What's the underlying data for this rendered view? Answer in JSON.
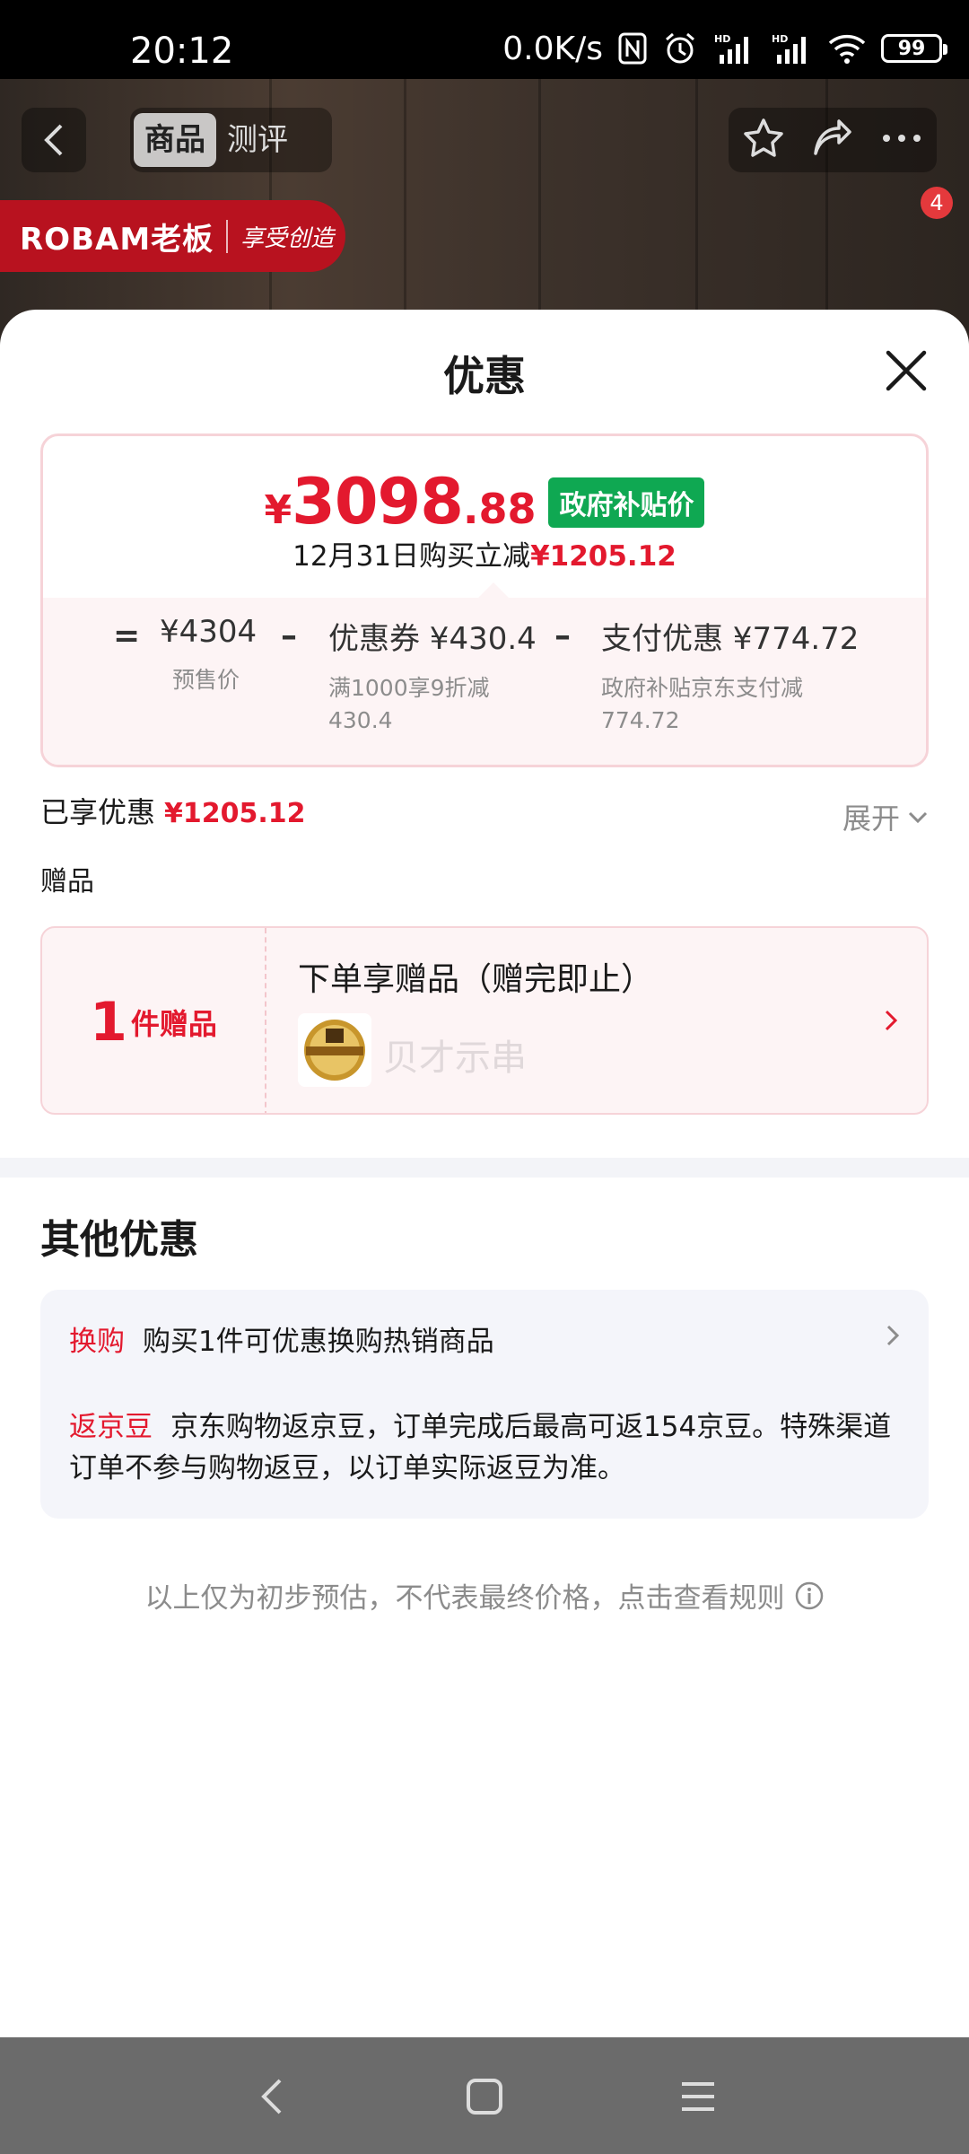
{
  "status_bar": {
    "time": "20:12",
    "net_speed": "0.0K/s",
    "battery": "99"
  },
  "header": {
    "tabs": [
      {
        "label": "商品",
        "active": true
      },
      {
        "label": "测评",
        "active": false
      }
    ],
    "cart_badge": "4",
    "brand_name": "ROBAM老板",
    "brand_slogan": "享受创造"
  },
  "sheet": {
    "title": "优惠",
    "price": {
      "symbol": "¥",
      "integer": "3098",
      "decimal": ".88",
      "tag": "政府补贴价",
      "subtitle_prefix": "12月31日购买立减",
      "subtitle_amount": "¥1205.12"
    },
    "breakdown": {
      "eq": "=",
      "minus": "–",
      "presale_amount": "¥4304",
      "presale_label": "预售价",
      "coupon_amount": "优惠券 ¥430.4",
      "coupon_note_1": "满1000享9折减",
      "coupon_note_2": "430.4",
      "pay_amount": "支付优惠 ¥774.72",
      "pay_note_1": "政府补贴京东支付减",
      "pay_note_2": "774.72"
    },
    "enjoyed_label": "已享优惠",
    "enjoyed_amount": "¥1205.12",
    "expand_label": "展开",
    "gift_section_label": "赠品",
    "gift": {
      "count": "1",
      "unit": "件赠品",
      "title": "下单享赠品（赠完即止）",
      "watermark": "贝才示串"
    },
    "other_title": "其他优惠",
    "other": [
      {
        "tag": "换购",
        "text": "购买1件可优惠换购热销商品"
      },
      {
        "tag": "返京豆",
        "text": "京东购物返京豆，订单完成后最高可返154京豆。特殊渠道订单不参与购物返豆，以订单实际返豆为准。"
      }
    ],
    "footnote": "以上仅为初步预估，不代表最终价格，点击查看规则"
  },
  "colors": {
    "accent_red": "#e3192e",
    "gov_green": "#0fa852"
  }
}
